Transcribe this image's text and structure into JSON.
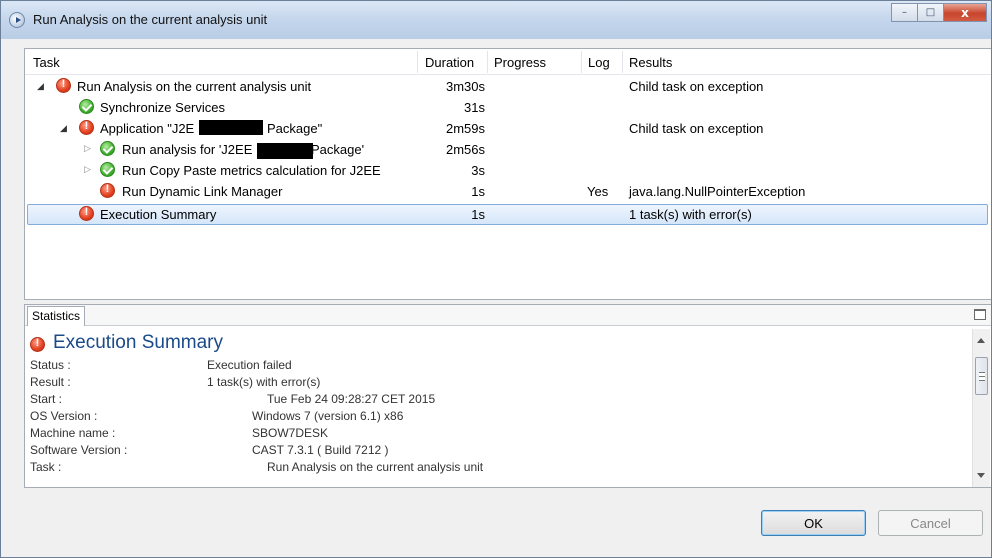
{
  "window": {
    "title": "Run Analysis on the current analysis unit",
    "minimize_label": "–",
    "maximize_label": "□",
    "close_label": "x"
  },
  "table": {
    "headers": {
      "task": "Task",
      "duration": "Duration",
      "progress": "Progress",
      "log": "Log",
      "results": "Results"
    },
    "rows": [
      {
        "task": "Run Analysis on the current analysis unit",
        "duration": "3m30s",
        "log": "",
        "results": "Child task on exception",
        "status": "error",
        "expander": "open",
        "level": 0
      },
      {
        "task": "Synchronize Services",
        "duration": "31s",
        "log": "",
        "results": "",
        "status": "ok",
        "expander": "none",
        "level": 1
      },
      {
        "task": "Application \"J2E",
        "task_suffix": "Package\"",
        "duration": "2m59s",
        "log": "",
        "results": "Child task on exception",
        "status": "error",
        "expander": "open",
        "level": 1
      },
      {
        "task": "Run analysis for 'J2EE",
        "task_suffix": "Package'",
        "duration": "2m56s",
        "log": "",
        "results": "",
        "status": "ok",
        "expander": "closed",
        "level": 2
      },
      {
        "task": "Run Copy Paste metrics calculation for J2EE",
        "duration": "3s",
        "log": "",
        "results": "",
        "status": "ok",
        "expander": "closed",
        "level": 2
      },
      {
        "task": "Run Dynamic Link Manager",
        "duration": "1s",
        "log": "Yes",
        "results": "java.lang.NullPointerException",
        "status": "error",
        "expander": "none",
        "level": 2
      },
      {
        "task": "Execution Summary",
        "duration": "1s",
        "log": "",
        "results": "1 task(s) with error(s)",
        "status": "error",
        "expander": "none",
        "level": 1,
        "selected": true
      }
    ]
  },
  "statistics": {
    "tab_label": "Statistics",
    "title": "Execution Summary",
    "fields": [
      {
        "label": "Status :",
        "value": "Execution failed"
      },
      {
        "label": "Result :",
        "value": "1 task(s) with error(s)"
      },
      {
        "label": "Start :",
        "value": "Tue Feb 24 09:28:27 CET 2015"
      },
      {
        "label": "OS Version :",
        "value": "Windows 7 (version 6.1) x86"
      },
      {
        "label": "Machine name :",
        "value": "SBOW7DESK"
      },
      {
        "label": "Software Version :",
        "value": "CAST 7.3.1 ( Build 7212 )"
      },
      {
        "label": "Task :",
        "value": "Run Analysis on the current analysis unit"
      }
    ]
  },
  "buttons": {
    "ok": "OK",
    "cancel": "Cancel"
  },
  "colors": {
    "error": "#e2401f",
    "ok": "#3fae2c",
    "title_blue": "#1a4a8a",
    "selection": "#d5e6fa"
  },
  "icons": {
    "error": "error-icon",
    "ok": "success-check-icon",
    "window": "run-icon"
  }
}
